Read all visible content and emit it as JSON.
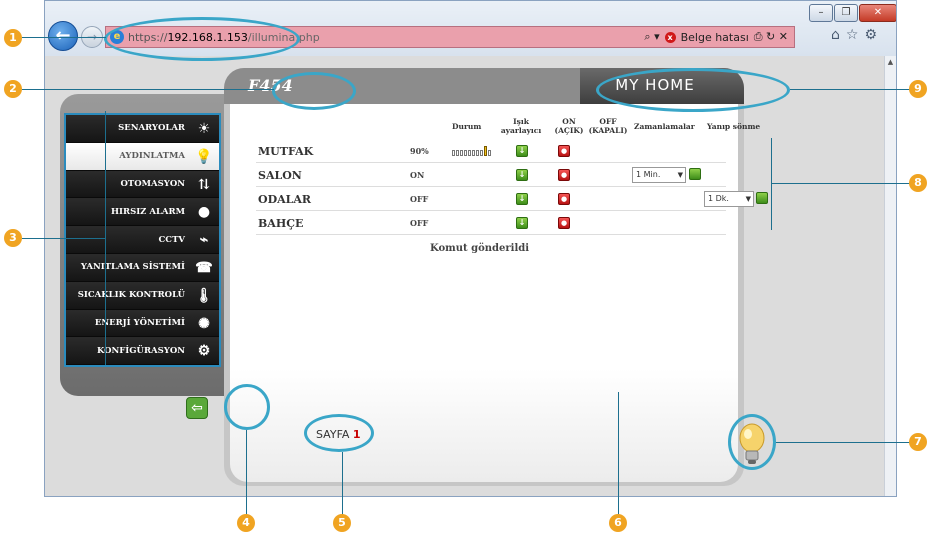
{
  "window": {
    "url_protocol": "https://",
    "url_host": "192.168.1.153",
    "url_path": "/illumina.php",
    "cert_error": "Belge hatası",
    "search_icon": "magnifier-icon",
    "min_glyph": "–",
    "max_glyph": "❐",
    "close_glyph": "✕",
    "back_glyph": "←",
    "fwd_glyph": "→",
    "ie_glyph": "e",
    "addr_tools": "⌕ ▾",
    "addr_tail": "⎙ ↻ ✕",
    "toolbar_glyphs": "⌂☆⚙"
  },
  "sidebar": {
    "items": [
      {
        "label": "SENARYOLAR",
        "icon": "scenario-icon",
        "glyph": "☀"
      },
      {
        "label": "AYDINLATMA",
        "icon": "lighting-icon",
        "glyph": "💡"
      },
      {
        "label": "OTOMASYON",
        "icon": "automation-icon",
        "glyph": "⇅"
      },
      {
        "label": "HIRSIZ ALARM",
        "icon": "alarm-icon",
        "glyph": "●"
      },
      {
        "label": "CCTV",
        "icon": "camera-icon",
        "glyph": "⌁"
      },
      {
        "label": "YANITLAMA SİSTEMİ",
        "icon": "answering-icon",
        "glyph": "☎"
      },
      {
        "label": "SICAKLIK KONTROLÜ",
        "icon": "thermometer-icon",
        "glyph": "🌡"
      },
      {
        "label": "ENERJİ YÖNETİMİ",
        "icon": "energy-icon",
        "glyph": "✺"
      },
      {
        "label": "KONFİGÜRASYON",
        "icon": "config-gear-icon",
        "glyph": "⚙"
      }
    ],
    "active_index": 1,
    "exit_glyph": "⇦"
  },
  "main": {
    "title": "F454",
    "brand": "MY HOME",
    "columns": {
      "status": "Durum",
      "dimmer_1": "Işık",
      "dimmer_2": "ayarlayıcı",
      "on_1": "ON",
      "on_2": "(AÇIK)",
      "off_1": "OFF",
      "off_2": "(KAPALI)",
      "timers": "Zamanlamalar",
      "blink": "Yanıp sönme"
    },
    "rows": [
      {
        "name": "MUTFAK",
        "status": "90%",
        "dimmer_level": 9
      },
      {
        "name": "SALON",
        "status": "ON",
        "timer": "1 Min."
      },
      {
        "name": "ODALAR",
        "status": "OFF",
        "blink": "1 Dk."
      },
      {
        "name": "BAHÇE",
        "status": "OFF"
      }
    ],
    "on_glyph": "↓",
    "off_glyph": "●",
    "dd_glyph": "▼",
    "message": "Komut gönderildi",
    "page_label": "SAYFA",
    "page_number": "1"
  },
  "callouts": [
    "1",
    "2",
    "3",
    "4",
    "5",
    "6",
    "7",
    "8",
    "9"
  ],
  "colors": {
    "accent_callout": "#3aa6c8",
    "callout_badge": "#f0a422",
    "on_green": "#5aa83a",
    "off_red": "#d01818"
  }
}
